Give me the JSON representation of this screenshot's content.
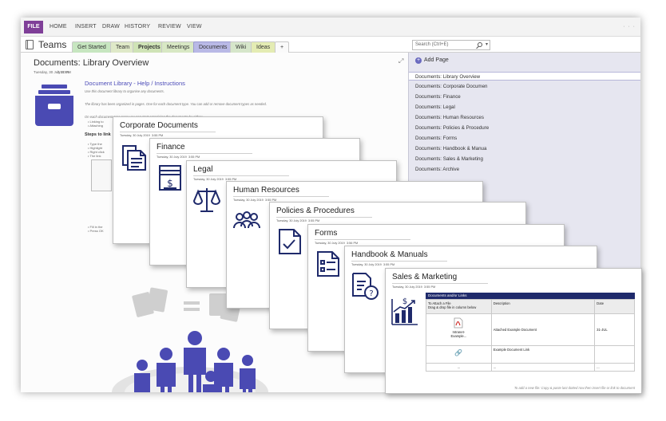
{
  "ribbon": {
    "file": "FILE",
    "tabs": [
      "HOME",
      "INSERT",
      "DRAW",
      "HISTORY",
      "REVIEW",
      "VIEW"
    ]
  },
  "notebook": {
    "name": "Teams",
    "sections": [
      "Get Started",
      "Team",
      "Projects",
      "Meetings",
      "Documents",
      "Wiki",
      "Ideas"
    ],
    "add_tab": "+",
    "search_placeholder": "Search (Ctrl+E)"
  },
  "page": {
    "title": "Documents: Library Overview",
    "date": "Tuesday, 30 July 2019",
    "time": "3:51 PM",
    "help_title": "Document Library - Help / Instructions",
    "help_lines": [
      "Use this document library to organise any documents.",
      "The library has been organized in pages. One for each document type. You can add or remove document types as needed.",
      "On each document type page you can start organising the documents by either:"
    ],
    "help_bullets": [
      "Linking to",
      "Attaching"
    ],
    "steps_title": "Steps to link",
    "steps_bullets": [
      "Type the",
      "Highlight",
      "Right click",
      "The link"
    ],
    "late_bullets": [
      "Fill in the",
      "Press OK"
    ]
  },
  "pane": {
    "add_page": "Add Page",
    "pages": [
      "Documents: Library Overview",
      "Documents: Corporate Documen",
      "Documents: Finance",
      "Documents: Legal",
      "Documents: Human Resources",
      "Documents: Policies & Procedure",
      "Documents: Forms",
      "Documents: Handbook & Manua",
      "Documents: Sales & Marketing",
      "Documents: Archive"
    ]
  },
  "cards": [
    {
      "title": "Corporate Documents",
      "date": "Tuesday, 30 July 2019",
      "time": "3:55 PM",
      "icon": "documents-icon"
    },
    {
      "title": "Finance",
      "date": "Tuesday, 30 July 2019",
      "time": "3:55 PM",
      "icon": "invoice-icon"
    },
    {
      "title": "Legal",
      "date": "Tuesday, 30 July 2019",
      "time": "3:55 PM",
      "icon": "scales-icon"
    },
    {
      "title": "Human Resources",
      "date": "Tuesday, 30 July 2019",
      "time": "3:55 PM",
      "icon": "people-icon"
    },
    {
      "title": "Policies & Procedures",
      "date": "Tuesday, 30 July 2019",
      "time": "3:55 PM",
      "icon": "checklist-icon"
    },
    {
      "title": "Forms",
      "date": "Tuesday, 30 July 2019",
      "time": "3:56 PM",
      "icon": "form-icon"
    },
    {
      "title": "Handbook & Manuals",
      "date": "Tuesday, 30 July 2019",
      "time": "3:55 PM",
      "icon": "question-doc-icon"
    },
    {
      "title": "Sales & Marketing",
      "date": "Tuesday, 30 July 2019",
      "time": "3:55 PM",
      "icon": "sales-chart-icon"
    }
  ],
  "sales_table": {
    "caption": "Documents and/or Links",
    "headers": [
      "To Attach a File\nDrag & drop file in column below",
      "Description",
      "Date"
    ],
    "rows": [
      {
        "file": "Intranet-\nExample...",
        "description": "Attached Example Document",
        "date": "31-JUL"
      },
      {
        "file": "",
        "description": "Example Document Link",
        "date": ""
      },
      {
        "file": "...",
        "description": "...",
        "date": "..."
      }
    ],
    "footer": "To add a new file: Copy & paste last dotted row then insert file or link to document"
  },
  "colors": {
    "brand_purple": "#7f3f98",
    "accent_navy": "#1f2a6b",
    "icon_blue": "#4a4ab3",
    "link_blue": "#4b4bb8"
  }
}
